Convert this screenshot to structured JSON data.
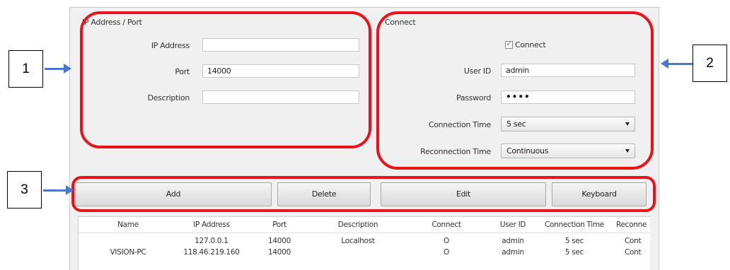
{
  "ip_port_section": {
    "title": "IP Address / Port",
    "ip_label": "IP Address",
    "ip_value": "",
    "port_label": "Port",
    "port_value": "14000",
    "description_label": "Description",
    "description_value": ""
  },
  "connect_section": {
    "title": "Connect",
    "connect_checkbox_label": "Connect",
    "connect_checked": true,
    "check_mark": "✓",
    "user_id_label": "User ID",
    "user_id_value": "admin",
    "password_label": "Password",
    "password_value": "••••",
    "connection_time_label": "Connection Time",
    "connection_time_value": "5 sec",
    "reconnection_time_label": "Reconnection Time",
    "reconnection_time_value": "Continuous"
  },
  "buttons": {
    "add": "Add",
    "delete": "Delete",
    "edit": "Edit",
    "keyboard": "Keyboard"
  },
  "table": {
    "columns": [
      "Name",
      "IP Address",
      "Port",
      "Description",
      "Connect",
      "User ID",
      "Connection Time",
      "Reconne"
    ],
    "rows": [
      [
        "",
        "127.0.0.1",
        "14000",
        "Localhost",
        "O",
        "admin",
        "5 sec",
        "Cont"
      ],
      [
        "VISION-PC",
        "118.46.219.160",
        "14000",
        "",
        "O",
        "admin",
        "5 sec",
        "Cont"
      ]
    ]
  },
  "callouts": [
    "1",
    "2",
    "3"
  ],
  "colors": {
    "highlight": "#e8141a",
    "arrow": "#4a78d0",
    "dialog_bg": "#f0f0f0"
  }
}
